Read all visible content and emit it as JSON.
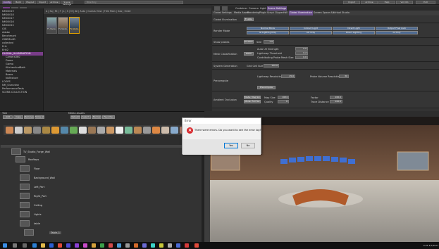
{
  "menubar": {
    "left_items": [
      "Config",
      "Build",
      "Playout",
      "Import",
      "Archive",
      "Scene Settings"
    ],
    "search_placeholder": "Directory",
    "right_items": [
      "Import",
      "Archive",
      "Help",
      "Viz Info",
      "Exit"
    ]
  },
  "left_panel": {
    "tree_items": [
      "NM00019",
      "NM00018",
      "NM00017",
      "NM00016",
      "NM00015",
      "GIS",
      "Adobe",
      "Benchmark",
      "CINEMA4D",
      "collected",
      "Erik",
      "Erik2",
      "GLOBAL_ILLUMINATION",
      "Camera360",
      "Dome",
      "Gizmo",
      "KitchenAndBath",
      "Materials",
      "Boxes",
      "NoTexture",
      "LOOPS",
      "NM_Overview",
      "PerformanceTests",
      "SCENE-COLLECTION"
    ],
    "toolbar_text": "A | Sq | Rt | F | L | S | M | All | Auto | Guests View | Title Main | Sub | Order",
    "thumbnails": [
      "TV_Studio_Forge",
      "TV_Studio_Forge2",
      "TV_Studio_Forge3"
    ]
  },
  "right_panel": {
    "tabs": [
      "Container",
      "Camera",
      "Light",
      "Scene Settings"
    ],
    "subtabs": [
      "Global Settings",
      "Media Asset",
      "Rendering",
      "Plugin",
      "Script",
      "Clipper",
      "HW",
      "Global Illumination",
      "Screen Space AA",
      "Virtual Studio"
    ],
    "active_subtab": "Global Illumination",
    "gi_label": "Global Illumination",
    "gi_toggle": "Enable",
    "render_mode_label": "Render Mode",
    "render_modes": [
      "Normal Mode",
      "Indirect Light",
      "Direct Light",
      "Output Final Look"
    ],
    "render_modes_row2": [
      "GI Lighting Only",
      "AO Only",
      "Direct Lighting",
      "GI Only"
    ],
    "show_probes_label": "Show probes",
    "show_probes_value": "Disabled",
    "size_label": "Size",
    "size_value": "1.0",
    "mesh_class_label": "Mesh Classification",
    "mesh_class_btn": "Static",
    "auto_uv_label": "Auto UV Strength",
    "auto_uv_value": "0.5",
    "lightmap_threshold_label": "Lightmap Threshold",
    "lightmap_threshold_value": "0.2",
    "contributing_label": "Contributing Probe Mesh Size",
    "contributing_value": "0.0",
    "system_gen_label": "System Generation",
    "grid_cell_label": "Grid Cell Size",
    "grid_cell_value": "100.0",
    "precompute_label": "Precompute",
    "lightmap_res_label": "Lightmap Resolution",
    "lightmap_res_value": "25.0",
    "probe_vol_label": "Probe Volume Resolution",
    "probe_vol_value": "30",
    "precompute_btn": "Precompute",
    "ao_label": "Ambient Occlusion",
    "ao_btn1": "Mode: Map Size",
    "ao_btn2": "Mode: Full Tex",
    "map_size_label": "Map Size",
    "map_size_value": "1024",
    "quality_label": "Quality",
    "quality_value": "8",
    "factor_label": "Factor",
    "factor_value": "100.0",
    "trace_distance_label": "Trace Distance",
    "trace_distance_value": "100.0"
  },
  "middle": {
    "tree_label": "Tree",
    "media_label": "Media Assets",
    "toolbar_buttons": [
      "Add",
      "Copy",
      "Remove",
      "Show All",
      "Rebuild",
      "Search",
      "Normal",
      "Favorites"
    ]
  },
  "scene_tree": {
    "nodes": [
      "TV_Studio_Forge_Wall",
      "Rooftops",
      "Floor",
      "Background_Wall",
      "Left_Part",
      "Right_Part",
      "Ceiling",
      "Lights",
      "table",
      "Table_1"
    ]
  },
  "dialog": {
    "title": "Error",
    "message": "There were errors. Do you want to see the error log?",
    "yes_label": "Yes",
    "no_label": "No"
  },
  "taskbar": {
    "time": "9:01",
    "date": "4/7/2017"
  },
  "colors": {
    "accent_purple": "#7a3d8a",
    "error_red": "#d8262b"
  }
}
